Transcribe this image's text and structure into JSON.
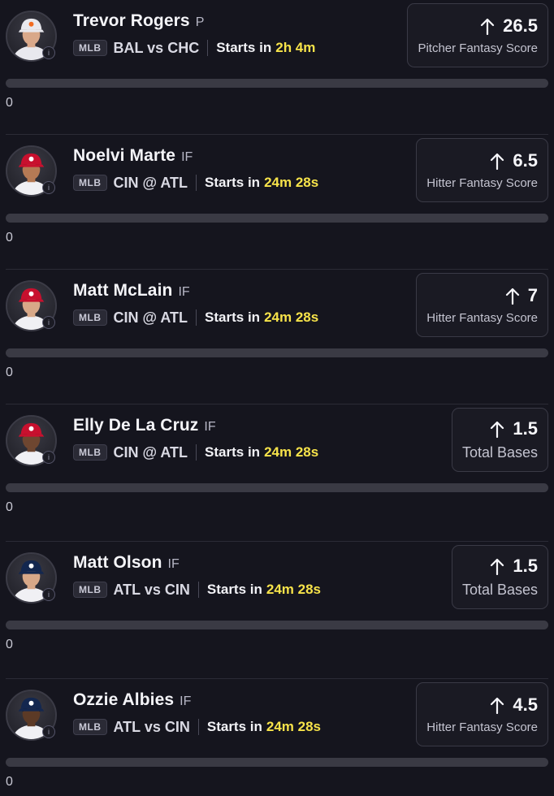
{
  "players": [
    {
      "name": "Trevor Rogers",
      "position": "P",
      "league": "MLB",
      "matchup": "BAL vs CHC",
      "starts_label": "Starts in",
      "starts_time": "2h 4m",
      "line": "26.5",
      "stat": "Pitcher Fantasy Score",
      "progress_value": "0",
      "progress_fraction": 0,
      "cap_color": "#e8e8ee",
      "cap_logo_color": "#f26b21",
      "jersey_color": "#e8e8ee",
      "skin_color": "#d9a88a",
      "hair_color": "#6b4a2a"
    },
    {
      "name": "Noelvi Marte",
      "position": "IF",
      "league": "MLB",
      "matchup": "CIN @ ATL",
      "starts_label": "Starts in",
      "starts_time": "24m 28s",
      "line": "6.5",
      "stat": "Hitter Fantasy Score",
      "progress_value": "0",
      "progress_fraction": 0,
      "cap_color": "#c8102e",
      "cap_logo_color": "#ffffff",
      "jersey_color": "#f0f0f4",
      "skin_color": "#b57a55",
      "hair_color": "#1e1410"
    },
    {
      "name": "Matt McLain",
      "position": "IF",
      "league": "MLB",
      "matchup": "CIN @ ATL",
      "starts_label": "Starts in",
      "starts_time": "24m 28s",
      "line": "7",
      "stat": "Hitter Fantasy Score",
      "progress_value": "0",
      "progress_fraction": 0,
      "cap_color": "#c8102e",
      "cap_logo_color": "#ffffff",
      "jersey_color": "#f0f0f4",
      "skin_color": "#d8a888",
      "hair_color": "#3a2618"
    },
    {
      "name": "Elly De La Cruz",
      "position": "IF",
      "league": "MLB",
      "matchup": "CIN @ ATL",
      "starts_label": "Starts in",
      "starts_time": "24m 28s",
      "line": "1.5",
      "stat": "Total Bases",
      "progress_value": "0",
      "progress_fraction": 0,
      "cap_color": "#c8102e",
      "cap_logo_color": "#ffffff",
      "jersey_color": "#f0f0f4",
      "skin_color": "#6e4630",
      "hair_color": "#1a1008"
    },
    {
      "name": "Matt Olson",
      "position": "IF",
      "league": "MLB",
      "matchup": "ATL vs CIN",
      "starts_label": "Starts in",
      "starts_time": "24m 28s",
      "line": "1.5",
      "stat": "Total Bases",
      "progress_value": "0",
      "progress_fraction": 0,
      "cap_color": "#13274f",
      "cap_logo_color": "#ffffff",
      "jersey_color": "#f0f0f4",
      "skin_color": "#d8a888",
      "hair_color": "#5a3a22"
    },
    {
      "name": "Ozzie Albies",
      "position": "IF",
      "league": "MLB",
      "matchup": "ATL vs CIN",
      "starts_label": "Starts in",
      "starts_time": "24m 28s",
      "line": "4.5",
      "stat": "Hitter Fantasy Score",
      "progress_value": "0",
      "progress_fraction": 0,
      "cap_color": "#13274f",
      "cap_logo_color": "#ffffff",
      "jersey_color": "#f0f0f4",
      "skin_color": "#5c3a26",
      "hair_color": "#140c06"
    }
  ],
  "accent_colors": {
    "starts_time": "#f7e34a",
    "background": "#15151e"
  },
  "icons": {
    "line_direction": "arrow-up-icon",
    "avatar_badge": "info-icon"
  }
}
